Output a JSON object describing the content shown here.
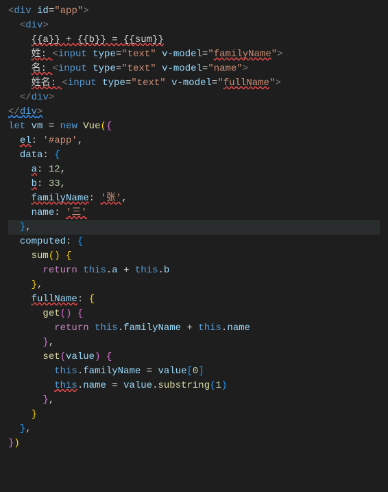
{
  "code": {
    "l1": {
      "o": "<",
      "t": "div",
      "sp": " ",
      "a": "id",
      "eq": "=",
      "q1": "\"",
      "v": "app",
      "q2": "\"",
      "c": ">"
    },
    "l2": {
      "pad": "  ",
      "o": "<",
      "t": "div",
      "c": ">"
    },
    "l3": {
      "pad": "    ",
      "exp": "{{a}} + {{b}} = {{sum}}"
    },
    "l4": {
      "pad": "    ",
      "label": "姓: ",
      "o": "<",
      "t": "input",
      "sp": " ",
      "a1": "type",
      "eq": "=",
      "q": "\"",
      "v1": "text",
      "qc": "\"",
      "sp2": " ",
      "a2": "v-model",
      "eq2": "=",
      "q2": "\"",
      "v2": "familyName",
      "q2c": "\"",
      "c": ">"
    },
    "l5": {
      "pad": "    ",
      "label": "名: ",
      "o": "<",
      "t": "input",
      "sp": " ",
      "a1": "type",
      "eq": "=",
      "q": "\"",
      "v1": "text",
      "qc": "\"",
      "sp2": " ",
      "a2": "v-model",
      "eq2": "=",
      "q2": "\"",
      "v2": "name",
      "q2c": "\"",
      "c": ">"
    },
    "l6": {
      "pad": "    ",
      "label": "姓名: ",
      "o": "<",
      "t": "input",
      "sp": " ",
      "a1": "type",
      "eq": "=",
      "q": "\"",
      "v1": "text",
      "qc": "\"",
      "sp2": " ",
      "a2": "v-model",
      "eq2": "=",
      "q2": "\"",
      "v2": "fullName",
      "q2c": "\"",
      "c": ">"
    },
    "l7": {
      "pad": "  ",
      "o": "</",
      "t": "div",
      "c": ">"
    },
    "l8": {
      "o": "</",
      "t": "div",
      "c": ">"
    },
    "l9": {
      "kw": "let",
      "sp": " ",
      "var": "vm",
      "sp2": " ",
      "eq": "=",
      "sp3": " ",
      "kw2": "new",
      "sp4": " ",
      "cls": "Vue",
      "po": "(",
      "bo": "{"
    },
    "l10": {
      "pad": "  ",
      "prop": "el",
      "col": ": ",
      "val": "'#app'",
      "com": ","
    },
    "l11": {
      "pad": "  ",
      "prop": "data",
      "col": ": ",
      "bo": "{"
    },
    "l12": {
      "pad": "    ",
      "prop": "a",
      "col": ": ",
      "val": "12",
      "com": ","
    },
    "l13": {
      "pad": "    ",
      "prop": "b",
      "col": ": ",
      "val": "33",
      "com": ","
    },
    "l14": {
      "pad": "    ",
      "prop": "familyName",
      "col": ": ",
      "val": "'张'",
      "com": ","
    },
    "l15": {
      "pad": "    ",
      "prop": "name",
      "col": ": ",
      "val": "'三'"
    },
    "l16": {
      "pad": "  ",
      "bc": "}",
      "com": ","
    },
    "l17": {
      "pad": "  ",
      "prop": "computed",
      "col": ": ",
      "bo": "{"
    },
    "l18": {
      "pad": "    ",
      "fn": "sum",
      "po": "(",
      ")": ")",
      "sp": " ",
      "bo": "{"
    },
    "l19": {
      "pad": "      ",
      "kw": "return",
      "sp": " ",
      "this": "this",
      "dot": ".",
      "p1": "a",
      "sp2": " ",
      "op": "+",
      "sp3": " ",
      "this2": "this",
      "dot2": ".",
      "p2": "b"
    },
    "l20": {
      "pad": "    ",
      "bc": "}",
      "com": ","
    },
    "l21": {
      "pad": "    ",
      "prop": "fullName",
      "col": ": ",
      "bo": "{"
    },
    "l22": {
      "pad": "      ",
      "fn": "get",
      "po": "(",
      ")": ")",
      "sp": " ",
      "bo": "{"
    },
    "l23": {
      "pad": "        ",
      "kw": "return",
      "sp": " ",
      "this": "this",
      "dot": ".",
      "p1": "familyName",
      "sp2": " ",
      "op": "+",
      "sp3": " ",
      "this2": "this",
      "dot2": ".",
      "p2": "name"
    },
    "l24": {
      "pad": "      ",
      "bc": "}",
      "com": ","
    },
    "l25": {
      "pad": "      ",
      "fn": "set",
      "po": "(",
      "arg": "value",
      ")": ")",
      "sp": " ",
      "bo": "{"
    },
    "l26": {
      "pad": "        ",
      "this": "this",
      "dot": ".",
      "p1": "familyName",
      "sp": " ",
      "eq": "=",
      "sp2": " ",
      "v": "value",
      "br": "[",
      "idx": "0",
      "brc": "]"
    },
    "l27": {
      "pad": "        ",
      "this": "this",
      "dot": ".",
      "p1": "name",
      "sp": " ",
      "eq": "=",
      "sp2": " ",
      "v": "value",
      "dot2": ".",
      "fn": "substring",
      "po": "(",
      "arg": "1",
      "pc": ")"
    },
    "l28": {
      "pad": "      ",
      "bc": "}",
      "com": ","
    },
    "l29": {
      "pad": "    ",
      "bc": "}"
    },
    "l30": {
      "pad": "  ",
      "bc": "}",
      "com": ","
    },
    "l31": {
      "bc": "}",
      "pc": ")"
    }
  }
}
